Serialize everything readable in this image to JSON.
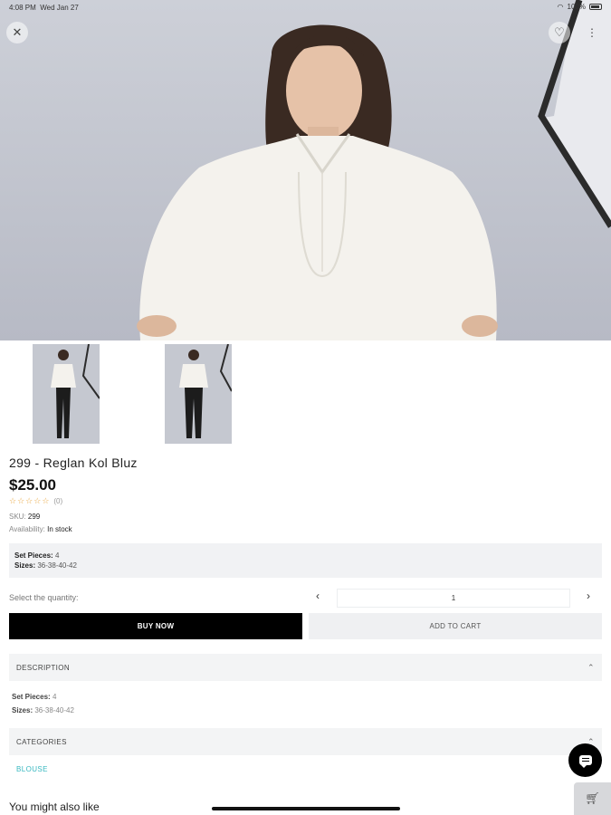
{
  "status_bar": {
    "time": "4:08 PM",
    "date": "Wed Jan 27",
    "battery": "100%"
  },
  "hero": {
    "close_icon": "close-icon",
    "wishlist_icon": "heart-icon",
    "more_icon": "more-vertical-icon"
  },
  "product": {
    "title": "299 - Reglan Kol Bluz",
    "price": "$25.00",
    "rating_stars": 0,
    "rating_count": "(0)",
    "sku_label": "SKU:",
    "sku_value": "299",
    "availability_label": "Availability:",
    "availability_value": "In stock"
  },
  "info_box": {
    "set_pieces_label": "Set Pieces:",
    "set_pieces_value": "4",
    "sizes_label": "Sizes:",
    "sizes_value": "36-38-40-42"
  },
  "quantity": {
    "label": "Select the quantity:",
    "value": "1",
    "prev_icon": "chevron-left-icon",
    "next_icon": "chevron-right-icon"
  },
  "actions": {
    "buy_now": "BUY NOW",
    "add_to_cart": "ADD TO CART"
  },
  "description": {
    "header": "DESCRIPTION",
    "set_pieces_label": "Set Pieces:",
    "set_pieces_value": "4",
    "sizes_label": "Sizes:",
    "sizes_value": "36-38-40-42"
  },
  "categories": {
    "header": "CATEGORIES",
    "items": [
      "BLOUSE"
    ]
  },
  "recommendations": {
    "title": "You might also like"
  },
  "colors": {
    "accent_link": "#38b8c0",
    "buy_now_bg": "#000000",
    "star": "#e8a43a"
  }
}
